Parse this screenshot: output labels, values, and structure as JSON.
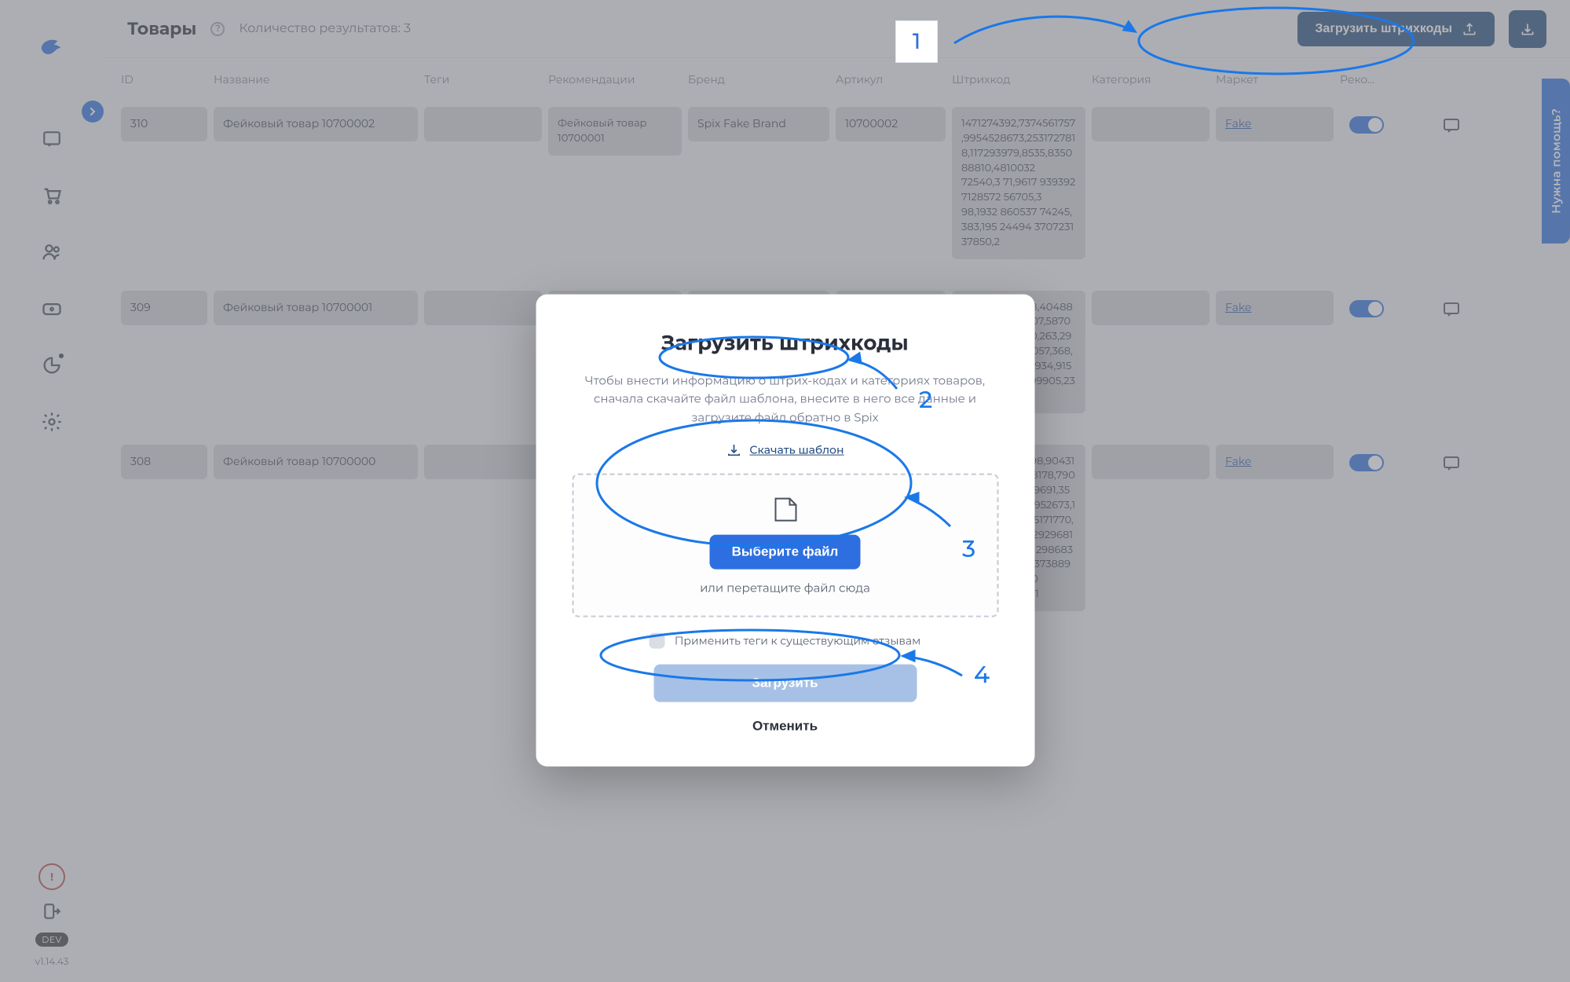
{
  "sidebar": {
    "dev_badge": "DEV",
    "version": "v1.14.43"
  },
  "help_tab": "Нужна помощь?",
  "header": {
    "title": "Товары",
    "count_label": "Количество результатов: 3",
    "upload_barcodes_btn": "Загрузить штрихкоды"
  },
  "columns": [
    "ID",
    "Название",
    "Теги",
    "Рекомендации",
    "Бренд",
    "Артикул",
    "Штрихкод",
    "Категория",
    "Маркет",
    "Реко...",
    ""
  ],
  "rows": [
    {
      "id": "310",
      "name": "Фейковый товар 10700002",
      "tags": "",
      "rec": "Фейковый товар 10700001",
      "brand": "Spix Fake Brand",
      "sku": "10700002",
      "barcode": "1471274392,7374561757,9954528673,2531727818,117293979,8535,835088810,4810032\n72540,3\n71,9617\n939392\n7128572\n56705,3\n98,1932\n860537\n74245,\n383,195\n24494\n3707231\n37850,2",
      "category": "",
      "market": "Fake",
      "enabled": true
    },
    {
      "id": "309",
      "name": "Фейковый товар 10700001",
      "tags": "",
      "rec": "",
      "brand": "",
      "sku": "",
      "barcode": "840,1921,84348,404880120774,36,3807,587026,437158,5860,263,2922,463993,329057,368,35,58,5548,343934,915592,5097,26,3,99905,239086",
      "category": "",
      "market": "Fake",
      "enabled": true
    },
    {
      "id": "308",
      "name": "Фейковый товар 10700000",
      "tags": "",
      "rec": "",
      "brand": "",
      "sku": "",
      "barcode": "908,3510844798,9043106648,5334338178,7901595110,4185969691,3592491724,5328952673,1505775891,2365171770,2519289019,4229296810524274406,912986838,72815292301,3738899925,711445350\n21,9131861985,31",
      "category": "",
      "market": "Fake",
      "enabled": true
    }
  ],
  "modal": {
    "title": "Загрузить штрихкоды",
    "desc": "Чтобы внести информацию о штрих-кодах и категориях товаров, сначала скачайте файл шаблона, внесите в него все данные и загрузите файл обратно в Spix",
    "template_link": "Скачать шаблон",
    "choose_file": "Выберите файл",
    "drag_hint": "или перетащите файл сюда",
    "apply_tags": "Применить теги к существующим отзывам",
    "upload": "Загрузить",
    "cancel": "Отменить"
  },
  "annotations": {
    "n1": "1",
    "n2": "2",
    "n3": "3",
    "n4": "4"
  }
}
